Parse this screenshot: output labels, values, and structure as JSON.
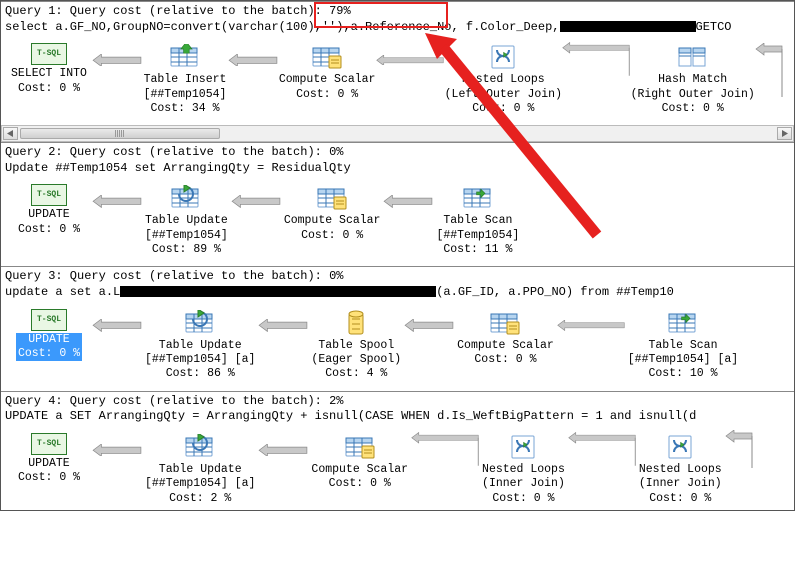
{
  "queries": [
    {
      "header_pre": "Query 1: Query cost (relative to the batch): ",
      "cost_pct": "79%",
      "sql_a": "select a.GF_NO,GroupNO=convert(varchar(100),''),a.Reference_No, f.Color_Deep,",
      "sql_b": "GETCO",
      "nodes": {
        "n0": {
          "label1": "SELECT INTO",
          "label2": "Cost: 0 %"
        },
        "n1": {
          "label1": "Table Insert",
          "label2": "[##Temp1054]",
          "label3": "Cost: 34 %"
        },
        "n2": {
          "label1": "Compute Scalar",
          "label2": "Cost: 0 %"
        },
        "n3": {
          "label1": "Nested Loops",
          "label2": "(Left Outer Join)",
          "label3": "Cost: 0 %"
        },
        "n4": {
          "label1": "Hash Match",
          "label2": "(Right Outer Join)",
          "label3": "Cost: 0 %"
        }
      }
    },
    {
      "header_pre": "Query 2: Query cost (relative to the batch): ",
      "cost_pct": "0%",
      "sql_a": "Update ##Temp1054 set ArrangingQty = ResidualQty",
      "nodes": {
        "n0": {
          "label1": "UPDATE",
          "label2": "Cost: 0 %"
        },
        "n1": {
          "label1": "Table Update",
          "label2": "[##Temp1054]",
          "label3": "Cost: 89 %"
        },
        "n2": {
          "label1": "Compute Scalar",
          "label2": "Cost: 0 %"
        },
        "n3": {
          "label1": "Table Scan",
          "label2": "[##Temp1054]",
          "label3": "Cost: 11 %"
        }
      }
    },
    {
      "header_pre": "Query 3: Query cost (relative to the batch): ",
      "cost_pct": "0%",
      "sql_a": "update a set a.L",
      "sql_b": "(a.GF_ID, a.PPO_NO)  from ##Temp10",
      "nodes": {
        "n0": {
          "label1": "UPDATE",
          "label2": "Cost: 0 %"
        },
        "n1": {
          "label1": "Table Update",
          "label2": "[##Temp1054] [a]",
          "label3": "Cost: 86 %"
        },
        "n2": {
          "label1": "Table Spool",
          "label2": "(Eager Spool)",
          "label3": "Cost: 4 %"
        },
        "n3": {
          "label1": "Compute Scalar",
          "label2": "Cost: 0 %"
        },
        "n4": {
          "label1": "Table Scan",
          "label2": "[##Temp1054] [a]",
          "label3": "Cost: 10 %"
        }
      }
    },
    {
      "header_pre": "Query 4: Query cost (relative to the batch): ",
      "cost_pct": "2%",
      "sql_a": "UPDATE a SET ArrangingQty = ArrangingQty + isnull(CASE WHEN d.Is_WeftBigPattern = 1 and isnull(d",
      "nodes": {
        "n0": {
          "label1": "UPDATE",
          "label2": "Cost: 0 %"
        },
        "n1": {
          "label1": "Table Update",
          "label2": "[##Temp1054] [a]",
          "label3": "Cost: 2 %"
        },
        "n2": {
          "label1": "Compute Scalar",
          "label2": "Cost: 0 %"
        },
        "n3": {
          "label1": "Nested Loops",
          "label2": "(Inner Join)",
          "label3": "Cost: 0 %"
        },
        "n4": {
          "label1": "Nested Loops",
          "label2": "(Inner Join)",
          "label3": "Cost: 0 %"
        }
      }
    }
  ],
  "scrollbar": {
    "thumb_width": 200
  },
  "tsql_text": "T-SQL"
}
